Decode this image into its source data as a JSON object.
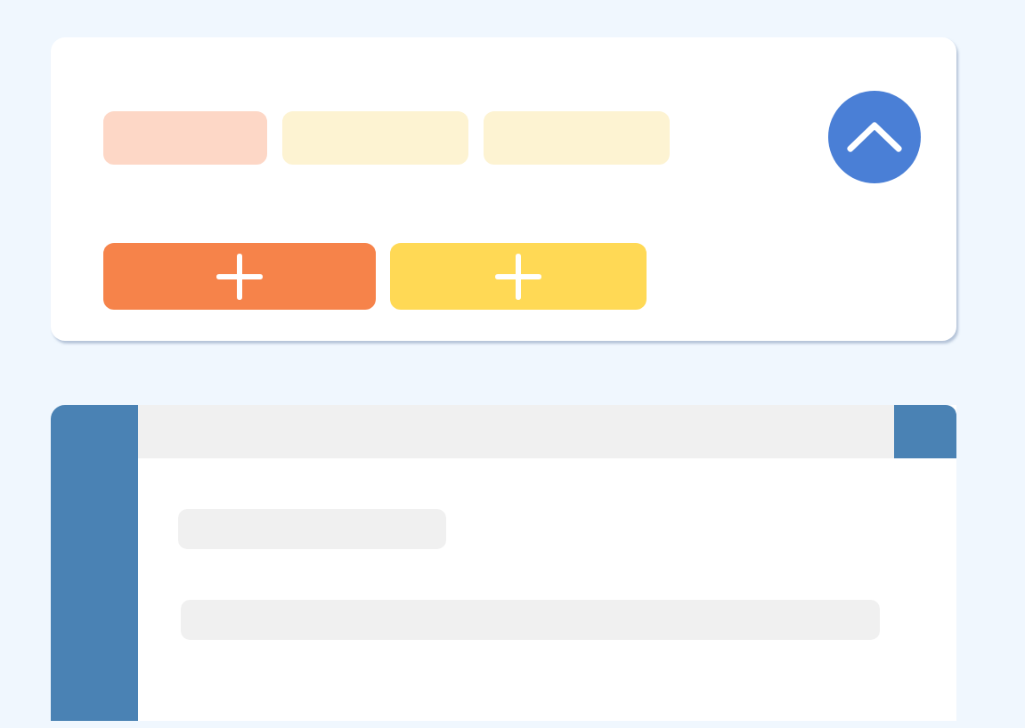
{
  "top_card": {
    "tags": [
      {
        "color": "#fdd7c6"
      },
      {
        "color": "#fdf3d2"
      },
      {
        "color": "#fdf3d2"
      }
    ],
    "add_buttons": [
      {
        "color": "#f6834a"
      },
      {
        "color": "#ffd955"
      }
    ],
    "collapse_button": {
      "expanded": true
    }
  }
}
